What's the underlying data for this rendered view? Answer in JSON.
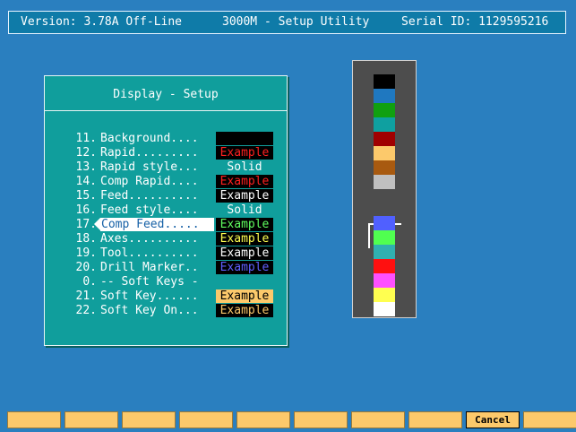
{
  "titlebar": {
    "version": "Version: 3.78A Off-Line",
    "name": "3000M - Setup Utility",
    "serial": "Serial ID: 1129595216"
  },
  "panel": {
    "title": "Display - Setup",
    "rows": [
      {
        "num": "11.",
        "label": "Background....",
        "value": "",
        "value_bg": "#000000",
        "value_fg": "#000000"
      },
      {
        "num": "12.",
        "label": "Rapid.........",
        "value": "Example",
        "value_bg": "#000000",
        "value_fg": "#ff2020"
      },
      {
        "num": "13.",
        "label": "Rapid style...",
        "value": "Solid",
        "value_bg": "transparent",
        "value_fg": "#ffffff"
      },
      {
        "num": "14.",
        "label": "Comp Rapid....",
        "value": "Example",
        "value_bg": "#000000",
        "value_fg": "#ff2020"
      },
      {
        "num": "15.",
        "label": "Feed..........",
        "value": "Example",
        "value_bg": "#000000",
        "value_fg": "#ffffff"
      },
      {
        "num": "16.",
        "label": "Feed style....",
        "value": "Solid",
        "value_bg": "transparent",
        "value_fg": "#ffffff"
      },
      {
        "num": "17.",
        "label": "Comp Feed.....",
        "value": "Example",
        "value_bg": "#000000",
        "value_fg": "#60ff60",
        "selected": true
      },
      {
        "num": "18.",
        "label": "Axes..........",
        "value": "Example",
        "value_bg": "#000000",
        "value_fg": "#ffff50"
      },
      {
        "num": "19.",
        "label": "Tool..........",
        "value": "Example",
        "value_bg": "#000000",
        "value_fg": "#ffffff"
      },
      {
        "num": "20.",
        "label": "Drill Marker..",
        "value": "Example",
        "value_bg": "#000000",
        "value_fg": "#6060ff"
      },
      {
        "num": "0.",
        "label": "-- Soft Keys -",
        "value": "",
        "value_bg": "transparent",
        "value_fg": "#ffffff"
      },
      {
        "num": "21.",
        "label": "Soft Key......",
        "value": "Example",
        "value_bg": "#fcc96b",
        "value_fg": "#000000"
      },
      {
        "num": "22.",
        "label": "Soft Key On...",
        "value": "Example",
        "value_bg": "#000000",
        "value_fg": "#fcc96b"
      }
    ]
  },
  "palette": {
    "colors": [
      "#000000",
      "#1f78c0",
      "#10a010",
      "#0fa0a0",
      "#a00000",
      "#fcc96b",
      "#a85a10",
      "#c0c0c0",
      "#5060ff",
      "#50ff50",
      "#30b0b0",
      "#ff1010",
      "#ff50ff",
      "#ffff50",
      "#ffffff"
    ],
    "selected_index": 9
  },
  "softkeys": {
    "labels": [
      "",
      "",
      "",
      "",
      "",
      "",
      "",
      "",
      "Cancel",
      ""
    ],
    "active_index": 8
  }
}
